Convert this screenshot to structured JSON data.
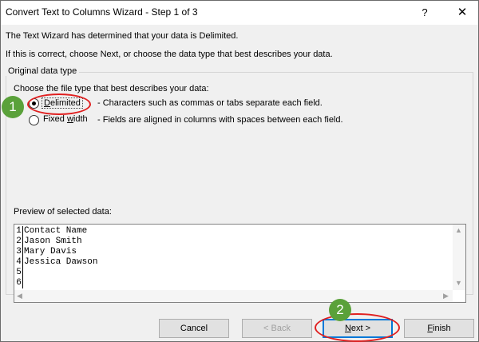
{
  "window": {
    "title": "Convert Text to Columns Wizard - Step 1 of 3",
    "help_icon": "?",
    "close_icon": "✕"
  },
  "info": {
    "line1": "The Text Wizard has determined that your data is Delimited.",
    "line2": "If this is correct, choose Next, or choose the data type that best describes your data."
  },
  "group": {
    "legend": "Original data type",
    "prompt": "Choose the file type that best describes your data:",
    "options": [
      {
        "label": "Delimited",
        "mnemonic": "D",
        "description": "- Characters such as commas or tabs separate each field.",
        "selected": true
      },
      {
        "label": "Fixed width",
        "mnemonic": "w",
        "description": "- Fields are aligned in columns with spaces between each field.",
        "selected": false
      }
    ]
  },
  "preview": {
    "label": "Preview of selected data:",
    "rows": [
      {
        "num": "1",
        "text": "Contact Name"
      },
      {
        "num": "2",
        "text": "Jason Smith"
      },
      {
        "num": "3",
        "text": "Mary Davis"
      },
      {
        "num": "4",
        "text": "Jessica Dawson"
      },
      {
        "num": "5",
        "text": ""
      },
      {
        "num": "6",
        "text": ""
      }
    ]
  },
  "buttons": {
    "cancel": "Cancel",
    "back": "< Back",
    "next": "Next >",
    "finish": "Finish"
  },
  "callouts": {
    "step1": "1",
    "step2": "2"
  },
  "colors": {
    "callout": "#5aa13a",
    "highlight": "#e02020",
    "focus": "#0078d7"
  }
}
